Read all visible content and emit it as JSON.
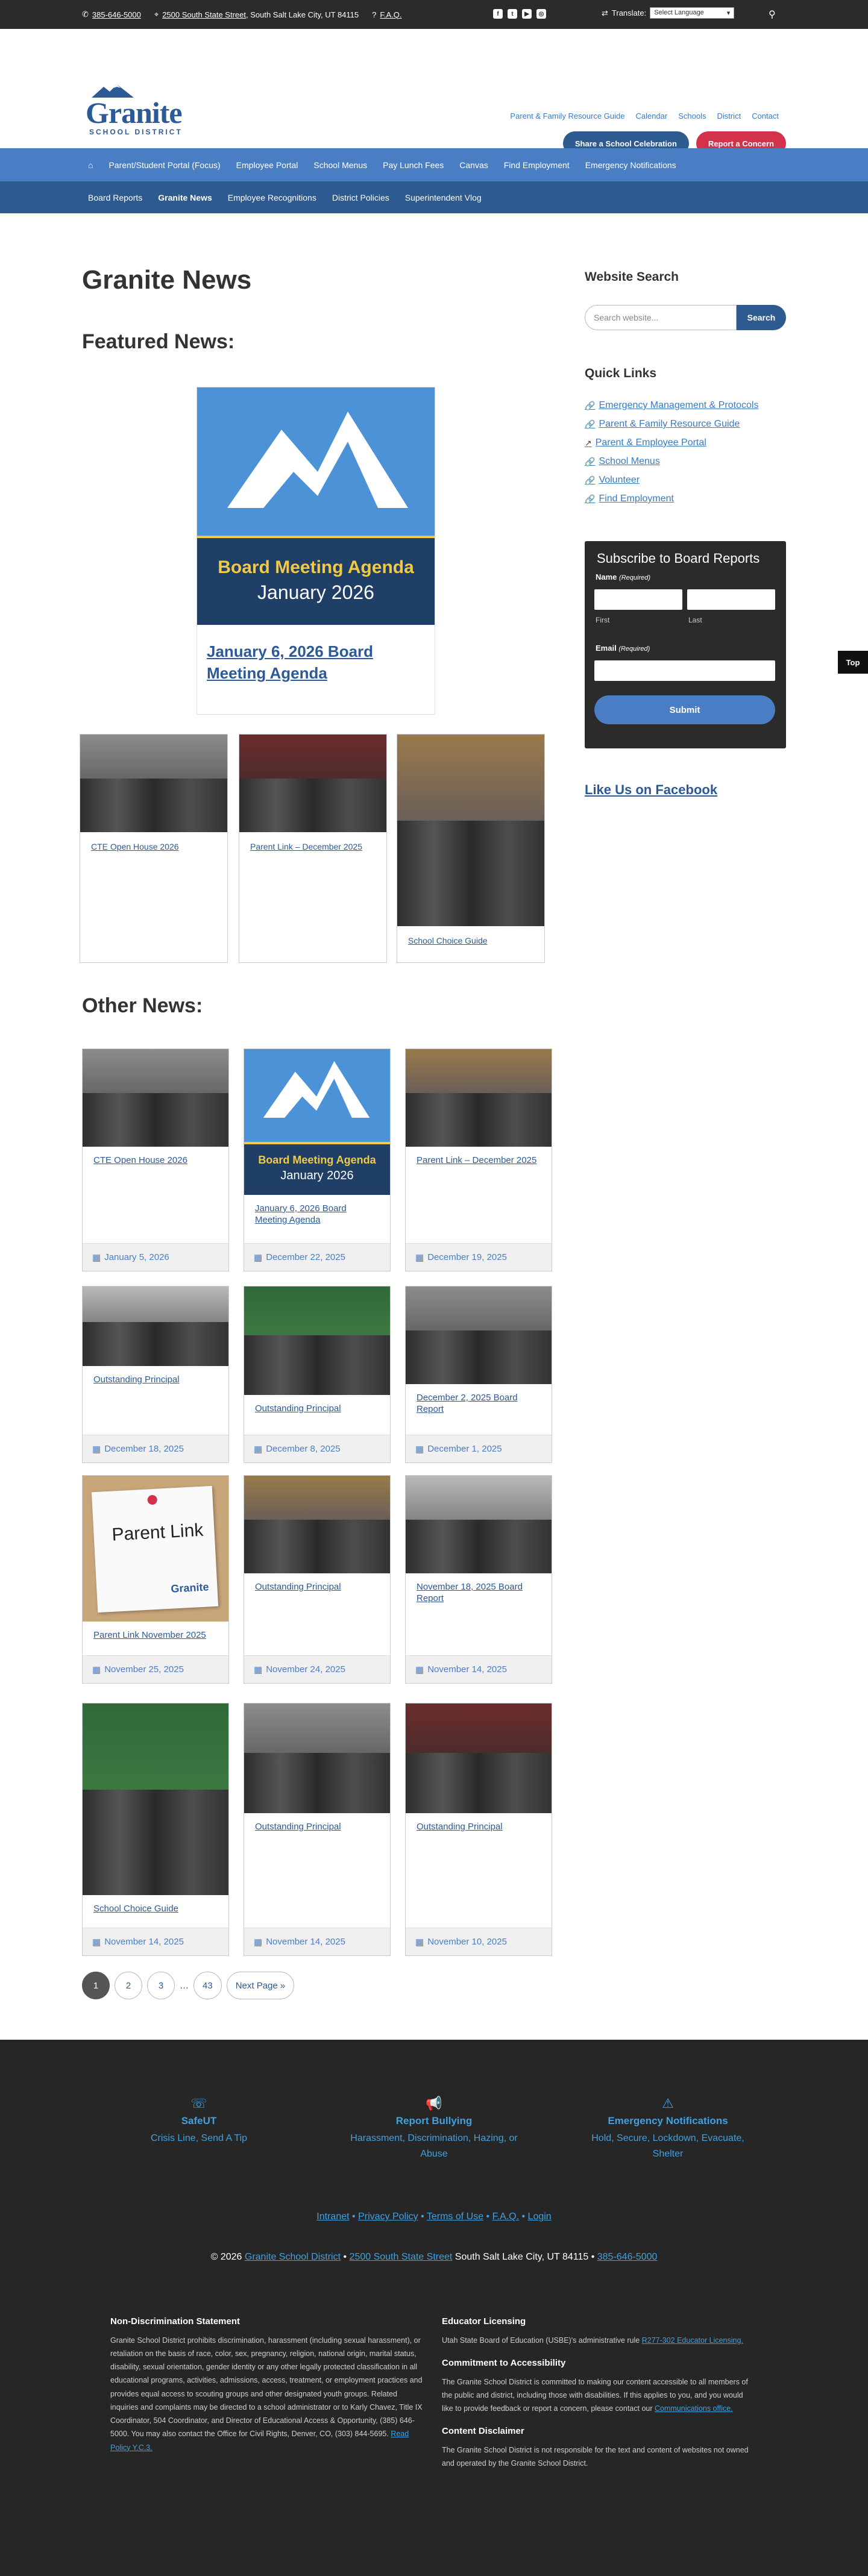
{
  "topbar": {
    "phone": "385-646-5000",
    "address_link": "2500 South State Street",
    "address_rest": ", South Salt Lake City, UT 84115",
    "faq": "F.A.Q.",
    "translate_label": "Translate:",
    "translate_select": "Select Language"
  },
  "header": {
    "logo_name": "Granite",
    "logo_sub": "SCHOOL DISTRICT",
    "links": [
      "Parent & Family Resource Guide",
      "Calendar",
      "Schools",
      "District",
      "Contact"
    ],
    "share_button": "Share a School Celebration",
    "report_button": "Report a Concern",
    "share_color": "#2d5a8f",
    "report_color": "#d3324a"
  },
  "nav1": [
    "Parent/Student Portal (Focus)",
    "Employee Portal",
    "School Menus",
    "Pay Lunch Fees",
    "Canvas",
    "Find Employment",
    "Emergency Notifications"
  ],
  "nav2": [
    "Board Reports",
    "Granite News",
    "Employee Recognitions",
    "District Policies",
    "Superintendent Vlog"
  ],
  "page": {
    "title": "Granite News",
    "featured_heading": "Featured News:",
    "other_heading": "Other News:"
  },
  "featured": {
    "main": {
      "img_line1": "Board Meeting Agenda",
      "img_line2": "January 2026",
      "title": "January 6, 2026 Board Meeting Agenda"
    },
    "small": [
      {
        "title": "CTE Open House 2026"
      },
      {
        "title": "Parent Link – December 2025"
      },
      {
        "title": "School Choice Guide"
      }
    ]
  },
  "news": [
    {
      "title": "CTE Open House 2026",
      "date": "January 5, 2026"
    },
    {
      "title": "January 6, 2026 Board Meeting Agenda",
      "date": "December 22, 2025",
      "img_line1": "Board Meeting Agenda",
      "img_line2": "January 2026"
    },
    {
      "title": "Parent Link – December 2025",
      "date": "December 19, 2025"
    },
    {
      "title": "Outstanding Principal",
      "date": "December 18, 2025"
    },
    {
      "title": "Outstanding Principal",
      "date": "December 8, 2025"
    },
    {
      "title": "December 2, 2025 Board Report",
      "date": "December 1, 2025"
    },
    {
      "title": "Parent Link November 2025",
      "date": "November 25, 2025",
      "img_text": "Parent Link",
      "img_brand": "Granite"
    },
    {
      "title": "Outstanding Principal",
      "date": "November 24, 2025"
    },
    {
      "title": "November 18, 2025 Board Report",
      "date": "November 14, 2025"
    },
    {
      "title": "School Choice Guide",
      "date": "November 14, 2025"
    },
    {
      "title": "Outstanding Principal",
      "date": "November 14, 2025"
    },
    {
      "title": "Outstanding Principal",
      "date": "November 10, 2025"
    }
  ],
  "pager": {
    "pages": [
      "1",
      "2",
      "3"
    ],
    "dots": "…",
    "last": "43",
    "next": "Next Page »"
  },
  "sidebar": {
    "search_heading": "Website Search",
    "search_placeholder": "Search website...",
    "search_button": "Search",
    "quick_heading": "Quick Links",
    "quick_links": [
      "Emergency Management & Protocols",
      "Parent & Family Resource Guide",
      "Parent & Employee Portal",
      "School Menus",
      "Volunteer",
      "Find Employment"
    ],
    "subscribe_title": "Subscribe to Board Reports",
    "name_label": "Name",
    "required": "(Required)",
    "first": "First",
    "last": "Last",
    "email_label": "Email",
    "submit": "Submit",
    "facebook": "Like Us on Facebook",
    "top_tab": "Top"
  },
  "footer": {
    "cols": [
      {
        "title": "SafeUT",
        "sub": "Crisis Line, Send A Tip"
      },
      {
        "title": "Report Bullying",
        "sub": "Harassment, Discrimination, Hazing, or Abuse"
      },
      {
        "title": "Emergency Notifications",
        "sub": "Hold, Secure, Lockdown, Evacuate, Shelter"
      }
    ],
    "links": [
      "Intranet",
      "Privacy Policy",
      "Terms of Use",
      "F.A.Q.",
      "Login"
    ],
    "sep": " • ",
    "copy_prefix": "© 2026 ",
    "copy_name": "Granite School District",
    "copy_dash": " • ",
    "copy_addr": "2500 South State Street",
    "copy_city": " South Salt Lake City, UT 84115 • ",
    "copy_phone": "385-646-5000",
    "nondisc_title": "Non-Discrimination Statement",
    "nondisc_text": "Granite School District prohibits discrimination, harassment (including sexual harassment), or retaliation on the basis of race, color, sex, pregnancy, religion, national origin, marital status, disability, sexual orientation, gender identity or any other legally protected classification in all educational programs, activities, admissions, access, treatment, or employment practices and provides equal access to scouting groups and other designated youth groups. Related inquiries and complaints may be directed to a school administrator or to Karly Chavez, Title IX Coordinator, 504 Coordinator, and Director of Educational Access & Opportunity, (385) 646-5000. You may also contact the Office for Civil Rights, Denver, CO, (303) 844-5695. ",
    "nondisc_link": "Read Policy Y.C.3.",
    "edu_title": "Educator Licensing",
    "edu_text": "Utah State Board of Education (USBE)'s administrative rule ",
    "edu_link": "R277-302 Educator Licensing.",
    "access_title": "Commitment to Accessibility",
    "access_text": "The Granite School District is committed to making our content accessible to all members of the public and district, including those with disabilities. If this applies to you, and you would like to provide feedback or report a concern, please contact our ",
    "access_link": "Communications office.",
    "disc_title": "Content Disclaimer",
    "disc_text": "The Granite School District is not responsible for the text and content of websites not owned and operated by the Granite School District."
  }
}
